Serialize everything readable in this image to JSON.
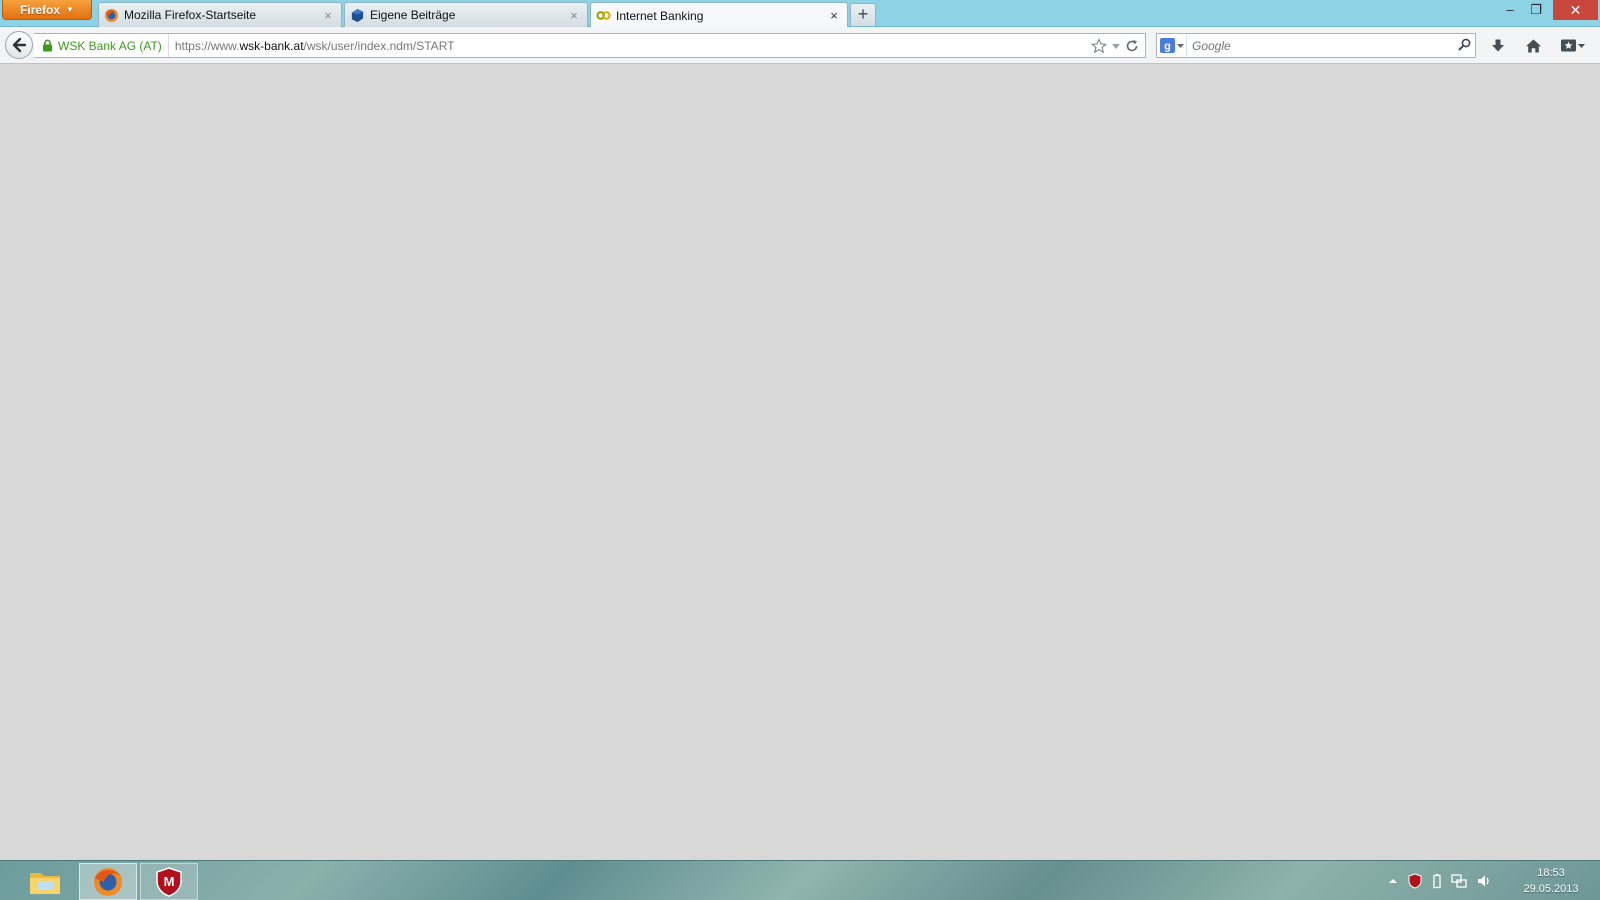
{
  "app": {
    "menu_button": "Firefox"
  },
  "tabs": [
    {
      "label": "Mozilla Firefox-Startseite",
      "icon": "firefox-icon",
      "active": false
    },
    {
      "label": "Eigene Beiträge",
      "icon": "blue-cube-icon",
      "active": false
    },
    {
      "label": "Internet Banking",
      "icon": "wsk-bank-icon",
      "active": true
    }
  ],
  "tab_close_glyph": "×",
  "new_tab_glyph": "+",
  "window_controls": {
    "minimize": "–",
    "maximize": "❐",
    "close": "✕"
  },
  "navbar": {
    "identity": "WSK Bank AG (AT)",
    "url_prefix": "https://www.",
    "url_host": "wsk-bank.at",
    "url_path": "/wsk/user/index.ndm/START",
    "search_placeholder": "Google"
  },
  "taskbar": {
    "time": "18:53",
    "date": "29.05.2013"
  },
  "colors": {
    "accent_orange": "#e2700f",
    "secure_green": "#3c9a1b",
    "close_red": "#c9463d",
    "content_bg": "#d8d8d8"
  }
}
